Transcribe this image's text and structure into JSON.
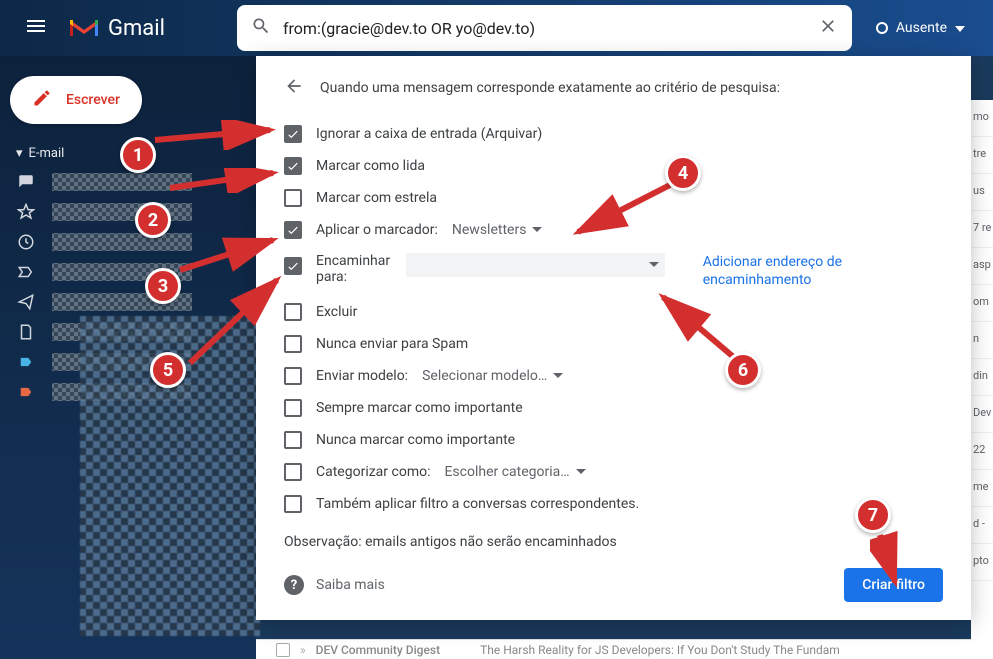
{
  "header": {
    "app_name": "Gmail",
    "search_value": "from:(gracie@dev.to OR yo@dev.to)",
    "status_label": "Ausente"
  },
  "sidebar": {
    "compose_label": "Escrever",
    "section_label": "E-mail"
  },
  "filter_panel": {
    "title": "Quando uma mensagem corresponde exatamente ao critério de pesquisa:",
    "options": {
      "skip_inbox": {
        "label": "Ignorar a caixa de entrada (Arquivar)",
        "checked": true
      },
      "mark_read": {
        "label": "Marcar como lida",
        "checked": true
      },
      "star": {
        "label": "Marcar com estrela",
        "checked": false
      },
      "apply_label": {
        "label": "Aplicar o marcador:",
        "value": "Newsletters",
        "checked": true
      },
      "forward": {
        "label": "Encaminhar para:",
        "checked": true,
        "add_link": "Adicionar endereço de encaminhamento"
      },
      "delete": {
        "label": "Excluir",
        "checked": false
      },
      "never_spam": {
        "label": "Nunca enviar para Spam",
        "checked": false
      },
      "send_template": {
        "label": "Enviar modelo:",
        "value": "Selecionar modelo…",
        "checked": false
      },
      "always_important": {
        "label": "Sempre marcar como importante",
        "checked": false
      },
      "never_important": {
        "label": "Nunca marcar como importante",
        "checked": false
      },
      "categorize": {
        "label": "Categorizar como:",
        "value": "Escolher categoria…",
        "checked": false
      },
      "apply_existing": {
        "label": "Também aplicar filtro a conversas correspondentes.",
        "checked": false
      }
    },
    "note": "Observação: emails antigos não serão encaminhados",
    "learn_more": "Saiba mais",
    "create_button": "Criar filtro"
  },
  "bottom_peek": {
    "sender": "DEV Community Digest",
    "subject": "The Harsh Reality for JS Developers: If You Don't Study The Fundam"
  },
  "annotations": {
    "n1": "1",
    "n2": "2",
    "n3": "3",
    "n4": "4",
    "n5": "5",
    "n6": "6",
    "n7": "7"
  },
  "right_edge_snippets": [
    "mo",
    "tre",
    "us",
    "7 re",
    "asp",
    "om",
    "n",
    "din",
    "Dev",
    "22",
    "me",
    "d -",
    "pto"
  ]
}
